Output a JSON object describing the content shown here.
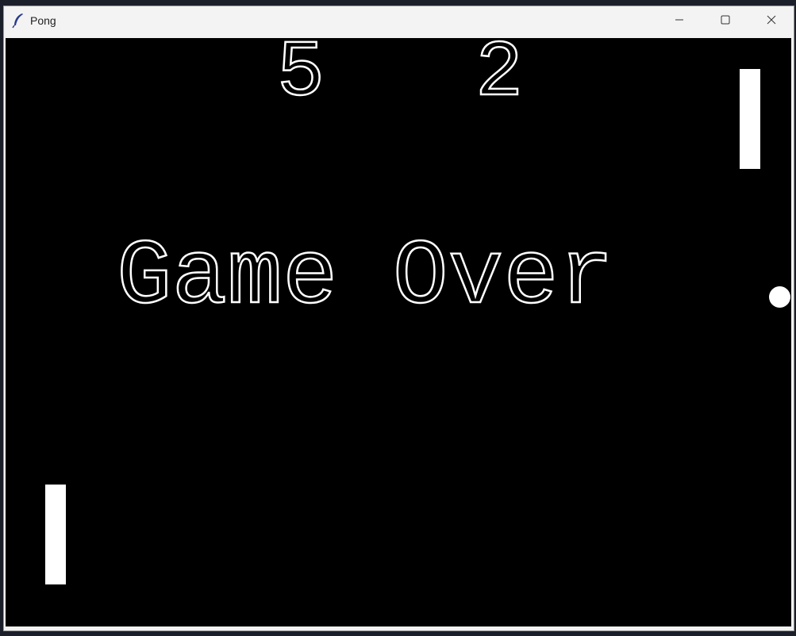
{
  "window": {
    "title": "Pong",
    "icon": "feather-icon",
    "controls": [
      "minimize-icon",
      "maximize-icon",
      "close-icon"
    ]
  },
  "game": {
    "score_left": "5",
    "score_right": "2",
    "message": "Game Over",
    "colors": {
      "background": "#000000",
      "foreground": "#ffffff"
    }
  }
}
